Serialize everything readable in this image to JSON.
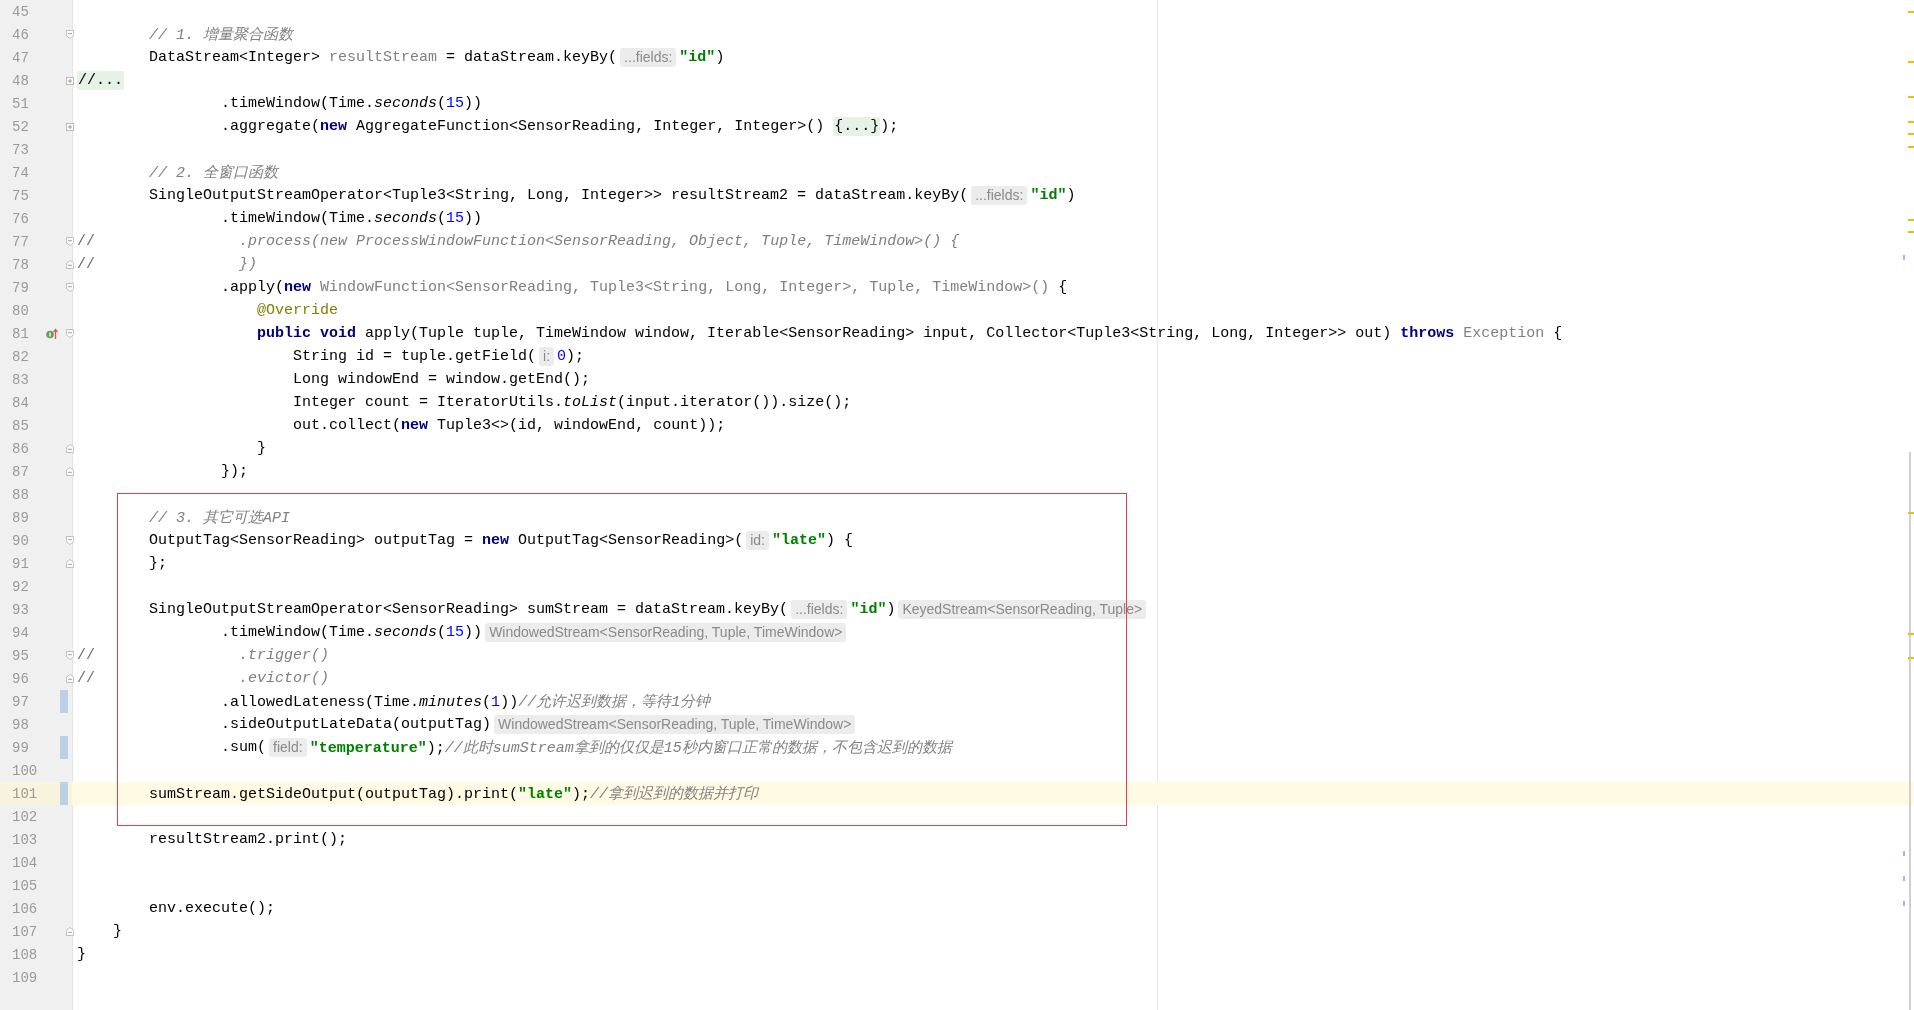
{
  "editor": {
    "sections": [
      {
        "kind": "plain",
        "lines": [
          {
            "number": "45",
            "kind": "normal"
          },
          {
            "number": "46",
            "kind": "normal",
            "fold_marker": {
              "collapsed": false,
              "opens": true
            },
            "tokens": [
              {
                "kind": "com",
                "text": "        // 1. 增量聚合函数"
              }
            ]
          },
          {
            "number": "47",
            "kind": "normal",
            "tokens": [
              {
                "kind": "t",
                "text": "        DataStream<Integer> "
              },
              {
                "kind": "dim",
                "text": "resultStream"
              },
              {
                "kind": "t",
                "text": " = dataStream.keyBy("
              },
              {
                "kind": "hint",
                "text": "...fields:"
              },
              {
                "kind": "str",
                "text": "\"id\""
              },
              {
                "kind": "t",
                "text": ")"
              }
            ]
          },
          {
            "number": "48",
            "kind": "normal",
            "fold_marker": {
              "collapsed": true
            },
            "tokens": [
              {
                "kind": "folded",
                "text": "//..."
              }
            ]
          },
          {
            "number": "51",
            "kind": "normal",
            "tokens": [
              {
                "kind": "t",
                "text": "                .timeWindow(Time."
              },
              {
                "kind": "ital",
                "text": "seconds"
              },
              {
                "kind": "t",
                "text": "("
              },
              {
                "kind": "num",
                "text": "15"
              },
              {
                "kind": "t",
                "text": "))"
              }
            ]
          },
          {
            "number": "52",
            "kind": "normal",
            "fold_marker": {
              "collapsed": true
            },
            "tokens": [
              {
                "kind": "t",
                "text": "                .aggregate("
              },
              {
                "kind": "kw",
                "text": "new"
              },
              {
                "kind": "t",
                "text": " AggregateFunction<SensorReading, Integer, Integer>() "
              },
              {
                "kind": "folded",
                "text": "{...}"
              },
              {
                "kind": "t",
                "text": ");"
              }
            ]
          },
          {
            "number": "73",
            "kind": "normal"
          },
          {
            "number": "74",
            "kind": "normal",
            "tokens": [
              {
                "kind": "com",
                "text": "        // 2. 全窗口函数"
              }
            ]
          },
          {
            "number": "75",
            "kind": "normal",
            "tokens": [
              {
                "kind": "t",
                "text": "        SingleOutputStreamOperator<Tuple3<String, Long, Integer>> resultStream2 = dataStream.keyBy("
              },
              {
                "kind": "hint",
                "text": "...fields:"
              },
              {
                "kind": "str",
                "text": "\"id\""
              },
              {
                "kind": "t",
                "text": ")"
              }
            ]
          },
          {
            "number": "76",
            "kind": "normal",
            "tokens": [
              {
                "kind": "t",
                "text": "                .timeWindow(Time."
              },
              {
                "kind": "ital",
                "text": "seconds"
              },
              {
                "kind": "t",
                "text": "("
              },
              {
                "kind": "num",
                "text": "15"
              },
              {
                "kind": "t",
                "text": "))"
              }
            ]
          },
          {
            "number": "77",
            "kind": "normal",
            "fold_marker": {
              "collapsed": false,
              "opens": true
            },
            "tokens": [
              {
                "kind": "lc",
                "text": "//"
              },
              {
                "kind": "dimital",
                "text": "                .process(new ProcessWindowFunction<SensorReading, Object, Tuple, TimeWindow>() {"
              }
            ]
          },
          {
            "number": "78",
            "kind": "normal",
            "fold_marker": {
              "collapsed": false,
              "opens": false
            },
            "tokens": [
              {
                "kind": "lc",
                "text": "//"
              },
              {
                "kind": "dimital",
                "text": "                })"
              }
            ]
          },
          {
            "number": "79",
            "kind": "normal",
            "fold_marker": {
              "collapsed": false,
              "opens": true
            },
            "tokens": [
              {
                "kind": "t",
                "text": "                .apply("
              },
              {
                "kind": "kw",
                "text": "new"
              },
              {
                "kind": "dim",
                "text": " WindowFunction<SensorReading, Tuple3<String, Long, Integer>, Tuple, TimeWindow>()"
              },
              {
                "kind": "t",
                "text": " {"
              }
            ]
          },
          {
            "number": "80",
            "kind": "normal",
            "tokens": [
              {
                "kind": "ann",
                "text": "                    @Override"
              }
            ]
          },
          {
            "number": "81",
            "kind": "normal",
            "gutter_icon": {
              "kind": "override"
            },
            "fold_marker": {
              "collapsed": false,
              "opens": true
            },
            "tokens": [
              {
                "kind": "kw",
                "text": "                    public void"
              },
              {
                "kind": "t",
                "text": " apply(Tuple tuple, TimeWindow window, Iterable<SensorReading> input, Collector<Tuple3<String, Long, Integer>> out) "
              },
              {
                "kind": "kw",
                "text": "throws"
              },
              {
                "kind": "dim",
                "text": " Exception"
              },
              {
                "kind": "t",
                "text": " {"
              }
            ]
          },
          {
            "number": "82",
            "kind": "normal",
            "tokens": [
              {
                "kind": "t",
                "text": "                        String id = tuple.getField("
              },
              {
                "kind": "hint",
                "text": "i:"
              },
              {
                "kind": "num",
                "text": "0"
              },
              {
                "kind": "t",
                "text": ");"
              }
            ]
          },
          {
            "number": "83",
            "kind": "normal",
            "tokens": [
              {
                "kind": "t",
                "text": "                        Long windowEnd = window.getEnd();"
              }
            ]
          },
          {
            "number": "84",
            "kind": "normal",
            "tokens": [
              {
                "kind": "t",
                "text": "                        Integer count = IteratorUtils."
              },
              {
                "kind": "ital",
                "text": "toList"
              },
              {
                "kind": "t",
                "text": "(input.iterator()).size();"
              }
            ]
          },
          {
            "number": "85",
            "kind": "normal",
            "tokens": [
              {
                "kind": "t",
                "text": "                        out.collect("
              },
              {
                "kind": "kw",
                "text": "new"
              },
              {
                "kind": "t",
                "text": " Tuple3<>(id, windowEnd, count));"
              }
            ]
          },
          {
            "number": "86",
            "kind": "normal",
            "fold_marker": {
              "collapsed": false,
              "opens": false
            },
            "tokens": [
              {
                "kind": "t",
                "text": "                    }"
              }
            ]
          },
          {
            "number": "87",
            "kind": "normal",
            "fold_marker": {
              "collapsed": false,
              "opens": false
            },
            "tokens": [
              {
                "kind": "t",
                "text": "                });"
              }
            ]
          }
        ]
      },
      {
        "kind": "boxed",
        "lines": [
          {
            "number": "88",
            "kind": "normal"
          },
          {
            "number": "89",
            "kind": "normal",
            "tokens": [
              {
                "kind": "com",
                "text": "        // 3. 其它可选API"
              }
            ]
          },
          {
            "number": "90",
            "kind": "normal",
            "fold_marker": {
              "collapsed": false,
              "opens": true
            },
            "tokens": [
              {
                "kind": "t",
                "text": "        OutputTag<SensorReading> outputTag = "
              },
              {
                "kind": "kw",
                "text": "new"
              },
              {
                "kind": "t",
                "text": " OutputTag<SensorReading>("
              },
              {
                "kind": "hint",
                "text": "id:"
              },
              {
                "kind": "str",
                "text": "\"late\""
              },
              {
                "kind": "t",
                "text": ") {"
              }
            ]
          },
          {
            "number": "91",
            "kind": "normal",
            "fold_marker": {
              "collapsed": false,
              "opens": false
            },
            "tokens": [
              {
                "kind": "t",
                "text": "        };"
              }
            ]
          },
          {
            "number": "92",
            "kind": "normal"
          },
          {
            "number": "93",
            "kind": "normal",
            "tokens": [
              {
                "kind": "t",
                "text": "        SingleOutputStreamOperator<SensorReading> sumStream = dataStream.keyBy("
              },
              {
                "kind": "hint",
                "text": "...fields:"
              },
              {
                "kind": "str",
                "text": "\"id\""
              },
              {
                "kind": "t",
                "text": ")"
              },
              {
                "kind": "hint",
                "text": "KeyedStream<SensorReading, Tuple>"
              }
            ]
          },
          {
            "number": "94",
            "kind": "normal",
            "tokens": [
              {
                "kind": "t",
                "text": "                .timeWindow(Time."
              },
              {
                "kind": "ital",
                "text": "seconds"
              },
              {
                "kind": "t",
                "text": "("
              },
              {
                "kind": "num",
                "text": "15"
              },
              {
                "kind": "t",
                "text": "))"
              },
              {
                "kind": "hint",
                "text": "WindowedStream<SensorReading, Tuple, TimeWindow>"
              }
            ]
          },
          {
            "number": "95",
            "kind": "normal",
            "fold_marker": {
              "collapsed": false,
              "opens": true
            },
            "tokens": [
              {
                "kind": "lc",
                "text": "//"
              },
              {
                "kind": "dimital",
                "text": "                .trigger()"
              }
            ]
          },
          {
            "number": "96",
            "kind": "normal",
            "fold_marker": {
              "collapsed": false,
              "opens": false
            },
            "tokens": [
              {
                "kind": "lc",
                "text": "//"
              },
              {
                "kind": "dimital",
                "text": "                .evictor()"
              }
            ]
          },
          {
            "number": "97",
            "kind": "changed",
            "tokens": [
              {
                "kind": "t",
                "text": "                .allowedLateness(Time."
              },
              {
                "kind": "ital",
                "text": "minutes"
              },
              {
                "kind": "t",
                "text": "("
              },
              {
                "kind": "num",
                "text": "1"
              },
              {
                "kind": "t",
                "text": "))"
              },
              {
                "kind": "com",
                "text": "//允许迟到数据，等待1分钟"
              }
            ]
          },
          {
            "number": "98",
            "kind": "normal",
            "tokens": [
              {
                "kind": "t",
                "text": "                .sideOutputLateData(outputTag)"
              },
              {
                "kind": "hint",
                "text": "WindowedStream<SensorReading, Tuple, TimeWindow>"
              }
            ]
          },
          {
            "number": "99",
            "kind": "changed",
            "tokens": [
              {
                "kind": "t",
                "text": "                .sum("
              },
              {
                "kind": "hint",
                "text": "field:"
              },
              {
                "kind": "str",
                "text": "\"temperature\""
              },
              {
                "kind": "t",
                "text": ");"
              },
              {
                "kind": "com",
                "text": "//此时sumStream拿到的仅仅是15秒内窗口正常的数据，不包含迟到的数据"
              }
            ]
          },
          {
            "number": "100",
            "kind": "normal"
          },
          {
            "number": "101",
            "kind": "current",
            "tokens": [
              {
                "kind": "t",
                "text": "        sumStream.getSideOutput(outputTag).print("
              },
              {
                "kind": "str",
                "text": "\"late\""
              },
              {
                "kind": "t",
                "text": ");"
              },
              {
                "kind": "com",
                "text": "//拿到迟到的数据并打印"
              }
            ]
          },
          {
            "number": "102",
            "kind": "normal"
          }
        ]
      },
      {
        "kind": "plain",
        "lines": [
          {
            "number": "103",
            "kind": "normal",
            "tokens": [
              {
                "kind": "t",
                "text": "        resultStream2.print();"
              }
            ]
          },
          {
            "number": "104",
            "kind": "normal"
          },
          {
            "number": "105",
            "kind": "normal"
          },
          {
            "number": "106",
            "kind": "normal",
            "tokens": [
              {
                "kind": "t",
                "text": "        env.execute();"
              }
            ]
          },
          {
            "number": "107",
            "kind": "normal",
            "fold_marker": {
              "collapsed": false,
              "opens": false
            },
            "tokens": [
              {
                "kind": "t",
                "text": "    }"
              }
            ]
          },
          {
            "number": "108",
            "kind": "normal",
            "tokens": [
              {
                "kind": "t",
                "text": "}"
              }
            ]
          },
          {
            "number": "109",
            "kind": "normal"
          }
        ]
      }
    ]
  }
}
